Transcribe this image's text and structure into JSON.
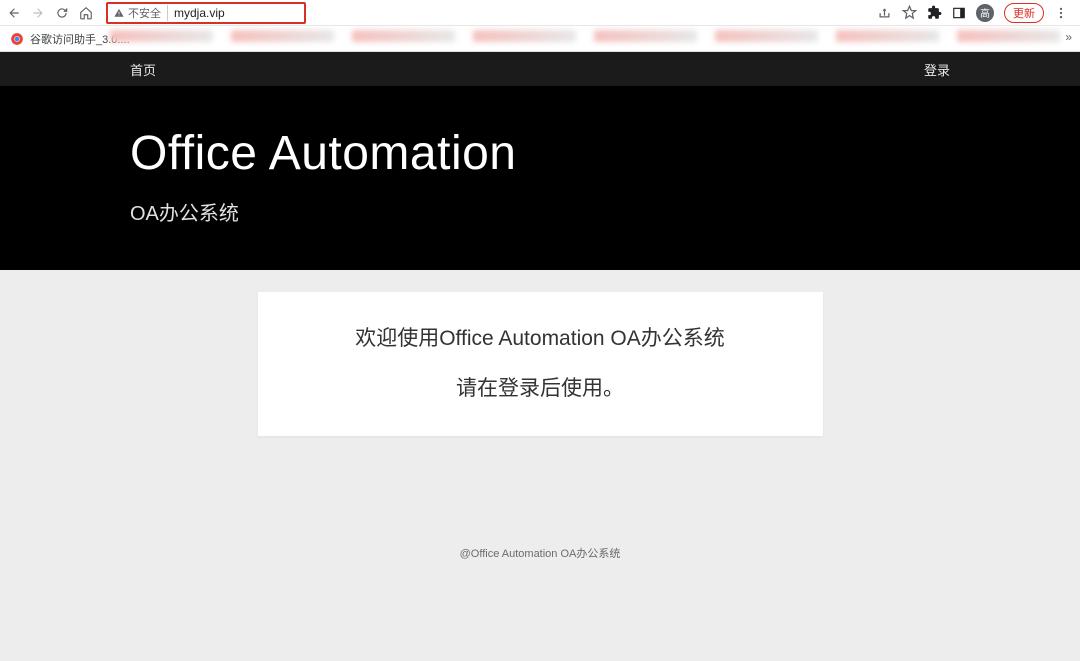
{
  "browser": {
    "security_label": "不安全",
    "url": "mydja.vip",
    "bookmark": "谷歌访问助手_3.0....",
    "update_label": "更新",
    "avatar_initial": "高"
  },
  "nav": {
    "home": "首页",
    "login": "登录"
  },
  "hero": {
    "title": "Office Automation",
    "subtitle": "OA办公系统"
  },
  "card": {
    "line1": "欢迎使用Office Automation OA办公系统",
    "line2": "请在登录后使用。"
  },
  "footer": {
    "text": "@Office Automation OA办公系统"
  }
}
